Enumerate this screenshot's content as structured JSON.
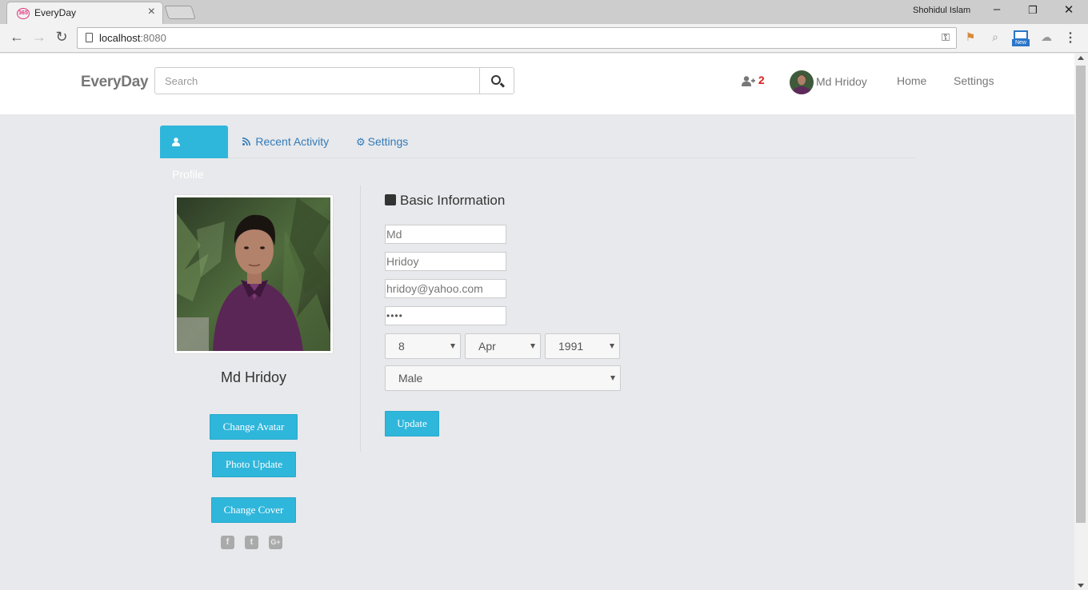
{
  "browser": {
    "tab_title": "EveryDay",
    "tab_favicon": "365",
    "window_user": "Shohidul Islam",
    "url_host": "localhost",
    "url_port": ":8080",
    "ext_new_label": "New"
  },
  "navbar": {
    "brand": "EveryDay",
    "search_placeholder": "Search",
    "friend_request_count": "2",
    "user_name": "Md Hridoy",
    "links": [
      "Home",
      "Settings"
    ]
  },
  "tabs": [
    {
      "label": "Profile",
      "icon": "user-icon",
      "active": true
    },
    {
      "label": "Recent Activity",
      "icon": "rss-icon",
      "active": false
    },
    {
      "label": "Settings",
      "icon": "gear-icon",
      "active": false
    }
  ],
  "profile": {
    "name": "Md Hridoy",
    "buttons": {
      "change_avatar": "Change Avatar",
      "photo_update": "Photo Update",
      "change_cover": "Change Cover"
    },
    "socials": [
      "facebook-icon",
      "twitter-icon",
      "google-plus-icon"
    ]
  },
  "form": {
    "section_title": "Basic Information",
    "first_name": "Md",
    "last_name": "Hridoy",
    "email": "hridoy@yahoo.com",
    "password_mask": "••••",
    "dob_day": "8",
    "dob_month": "Apr",
    "dob_year": "1991",
    "gender": "Male",
    "update_label": "Update"
  },
  "colors": {
    "accent": "#2fb6db",
    "link": "#337ab7",
    "badge": "#d9201c",
    "page_bg": "#e8e9ec"
  }
}
